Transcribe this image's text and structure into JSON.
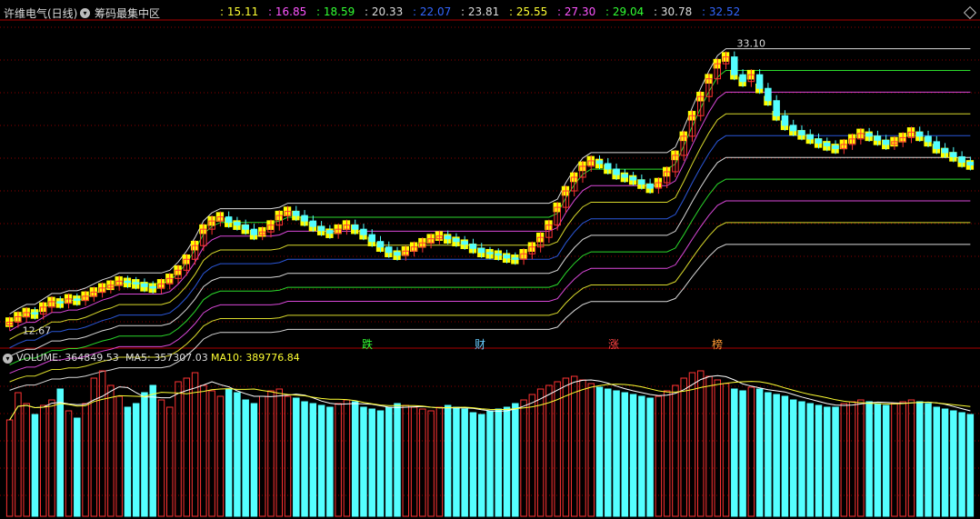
{
  "header": {
    "stock_title": "许维电气(日线)",
    "indicator_name": "筹码最集中区",
    "levels": [
      {
        "text": ": 15.11",
        "color": "#ffff33"
      },
      {
        "text": ": 16.85",
        "color": "#ff55ff"
      },
      {
        "text": ": 18.59",
        "color": "#33ff33"
      },
      {
        "text": ": 20.33",
        "color": "#dddddd"
      },
      {
        "text": ": 22.07",
        "color": "#3366ff"
      },
      {
        "text": ": 23.81",
        "color": "#dddddd"
      },
      {
        "text": ": 25.55",
        "color": "#ffff33"
      },
      {
        "text": ": 27.30",
        "color": "#ff55ff"
      },
      {
        "text": ": 29.04",
        "color": "#33ff33"
      },
      {
        "text": ": 30.78",
        "color": "#dddddd"
      },
      {
        "text": ": 32.52",
        "color": "#3366ff"
      }
    ]
  },
  "volume_header": {
    "volume": "VOLUME: 364849.53",
    "ma5": "MA5: 357307.03",
    "ma10": "MA10: 389776.84"
  },
  "annotations": {
    "high_label": "33.10",
    "low_label": "12.67"
  },
  "badges": [
    {
      "text": "跌",
      "color": "#33ff33"
    },
    {
      "text": "财",
      "color": "#66ccff"
    },
    {
      "text": "涨",
      "color": "#ff4444"
    },
    {
      "text": "榜",
      "color": "#ff9933"
    }
  ],
  "colors": {
    "up": "#ff3333",
    "down": "#54ffff",
    "chip_bar": "#ffff00",
    "grid": "#8b0000",
    "ma5": "#ffffff",
    "ma10": "#ffff33"
  },
  "chart_data": {
    "type": "candlestick",
    "price_ylim": [
      11.5,
      34.5
    ],
    "volume_ylim": [
      0,
      420000
    ],
    "grid": true,
    "closes": [
      12.4,
      12.8,
      13.1,
      13.0,
      13.5,
      13.9,
      13.8,
      14.1,
      14.0,
      14.3,
      14.6,
      14.9,
      15.1,
      15.4,
      15.3,
      15.2,
      15.0,
      14.9,
      15.2,
      15.6,
      16.2,
      17.0,
      18.0,
      19.2,
      19.8,
      20.1,
      19.7,
      19.5,
      19.2,
      18.8,
      19.0,
      19.5,
      20.2,
      20.5,
      20.2,
      19.8,
      19.4,
      19.1,
      18.9,
      19.2,
      19.5,
      19.2,
      18.8,
      18.3,
      17.9,
      17.5,
      17.3,
      17.6,
      17.9,
      18.2,
      18.5,
      18.7,
      18.5,
      18.3,
      18.1,
      17.8,
      17.5,
      17.4,
      17.3,
      17.1,
      17.0,
      17.4,
      17.9,
      18.6,
      19.5,
      20.8,
      22.0,
      23.0,
      23.8,
      24.2,
      24.0,
      23.6,
      23.2,
      23.0,
      22.8,
      22.5,
      22.2,
      22.6,
      23.4,
      24.6,
      26.0,
      27.5,
      28.9,
      30.2,
      31.3,
      31.8,
      30.5,
      30.0,
      30.5,
      29.5,
      28.6,
      27.5,
      26.8,
      26.4,
      26.1,
      25.8,
      25.5,
      25.3,
      25.1,
      25.4,
      25.8,
      26.2,
      26.0,
      25.7,
      25.4,
      25.6,
      25.9,
      26.3,
      26.0,
      25.6,
      25.1,
      24.8,
      24.5,
      24.1,
      23.9
    ],
    "volumes": [
      265000,
      340000,
      310000,
      280000,
      305000,
      320000,
      350000,
      290000,
      270000,
      310000,
      380000,
      400000,
      360000,
      330000,
      300000,
      310000,
      340000,
      360000,
      320000,
      300000,
      370000,
      380000,
      395000,
      360000,
      345000,
      330000,
      350000,
      340000,
      320000,
      310000,
      330000,
      345000,
      350000,
      330000,
      325000,
      315000,
      310000,
      305000,
      300000,
      310000,
      320000,
      315000,
      300000,
      295000,
      290000,
      300000,
      310000,
      305000,
      300000,
      295000,
      290000,
      300000,
      305000,
      300000,
      295000,
      285000,
      280000,
      290000,
      295000,
      300000,
      310000,
      320000,
      335000,
      350000,
      360000,
      370000,
      380000,
      385000,
      375000,
      365000,
      355000,
      350000,
      345000,
      340000,
      335000,
      330000,
      325000,
      330000,
      345000,
      360000,
      380000,
      395000,
      400000,
      385000,
      375000,
      365000,
      350000,
      345000,
      355000,
      350000,
      340000,
      335000,
      330000,
      320000,
      315000,
      310000,
      305000,
      300000,
      300000,
      310000,
      315000,
      320000,
      315000,
      310000,
      305000,
      310000,
      315000,
      320000,
      315000,
      310000,
      300000,
      295000,
      290000,
      285000,
      280000
    ],
    "ma5_label": "MA5",
    "ma10_label": "MA10"
  }
}
